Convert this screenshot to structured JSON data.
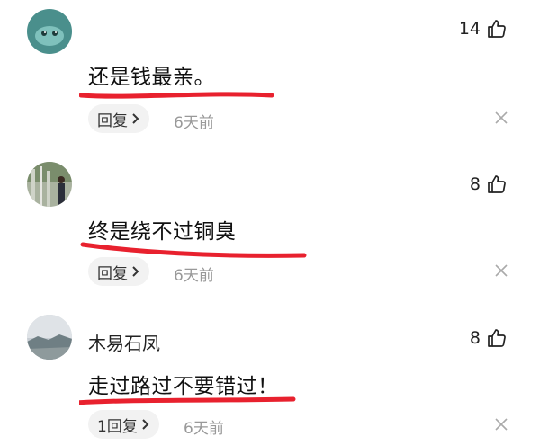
{
  "comments": [
    {
      "username": "",
      "text": "还是钱最亲。",
      "likes": "14",
      "reply_label": "回复",
      "time": "6天前"
    },
    {
      "username": "",
      "text": "终是绕不过铜臭",
      "likes": "8",
      "reply_label": "回复",
      "time": "6天前"
    },
    {
      "username": "木易石凤",
      "text": "走过路过不要错过！",
      "likes": "8",
      "reply_label": "1回复",
      "time": "6天前"
    }
  ],
  "colors": {
    "underline": "#e8212e",
    "text": "#111111",
    "muted": "#999999",
    "reply_bg": "#f2f2f2"
  },
  "icons": [
    "avatar",
    "thumbs-up-icon",
    "chevron-right-icon",
    "close-icon"
  ]
}
